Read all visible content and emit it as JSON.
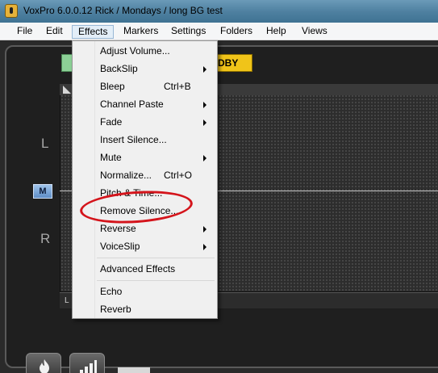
{
  "window": {
    "title": "VoxPro 6.0.0.12    Rick / Mondays / long BG test"
  },
  "menubar": {
    "items": [
      "File",
      "Edit",
      "Effects",
      "Markers",
      "Settings",
      "Folders",
      "Help",
      "Views"
    ],
    "active": "Effects"
  },
  "effects_menu": {
    "items": [
      {
        "label": "Adjust Volume...",
        "shortcut": "",
        "submenu": false
      },
      {
        "label": "BackSlip",
        "shortcut": "",
        "submenu": true
      },
      {
        "label": "Bleep",
        "shortcut": "Ctrl+B",
        "submenu": false
      },
      {
        "label": "Channel Paste",
        "shortcut": "",
        "submenu": true
      },
      {
        "label": "Fade",
        "shortcut": "",
        "submenu": true
      },
      {
        "label": "Insert Silence...",
        "shortcut": "",
        "submenu": false
      },
      {
        "label": "Mute",
        "shortcut": "",
        "submenu": true
      },
      {
        "label": "Normalize...",
        "shortcut": "Ctrl+O",
        "submenu": false
      },
      {
        "label": "Pitch & Time...",
        "shortcut": "",
        "submenu": false
      },
      {
        "label": "Remove Silence...",
        "shortcut": "",
        "submenu": false,
        "highlighted": true
      },
      {
        "label": "Reverse",
        "shortcut": "",
        "submenu": true
      },
      {
        "label": "VoiceSlip",
        "shortcut": "",
        "submenu": true
      },
      {
        "label": "Advanced Effects",
        "shortcut": "",
        "submenu": false
      },
      {
        "label": "Echo",
        "shortcut": "",
        "submenu": false
      },
      {
        "label": "Reverb",
        "shortcut": "",
        "submenu": false
      }
    ]
  },
  "editor": {
    "channel_left": "L",
    "channel_right": "R",
    "mute_button": "M",
    "tab_label": "DBY",
    "bottom_label": "L"
  },
  "toolbar": {
    "icons": [
      "flame-icon",
      "meter-icon"
    ]
  },
  "annotation": {
    "color": "#d4141b"
  }
}
